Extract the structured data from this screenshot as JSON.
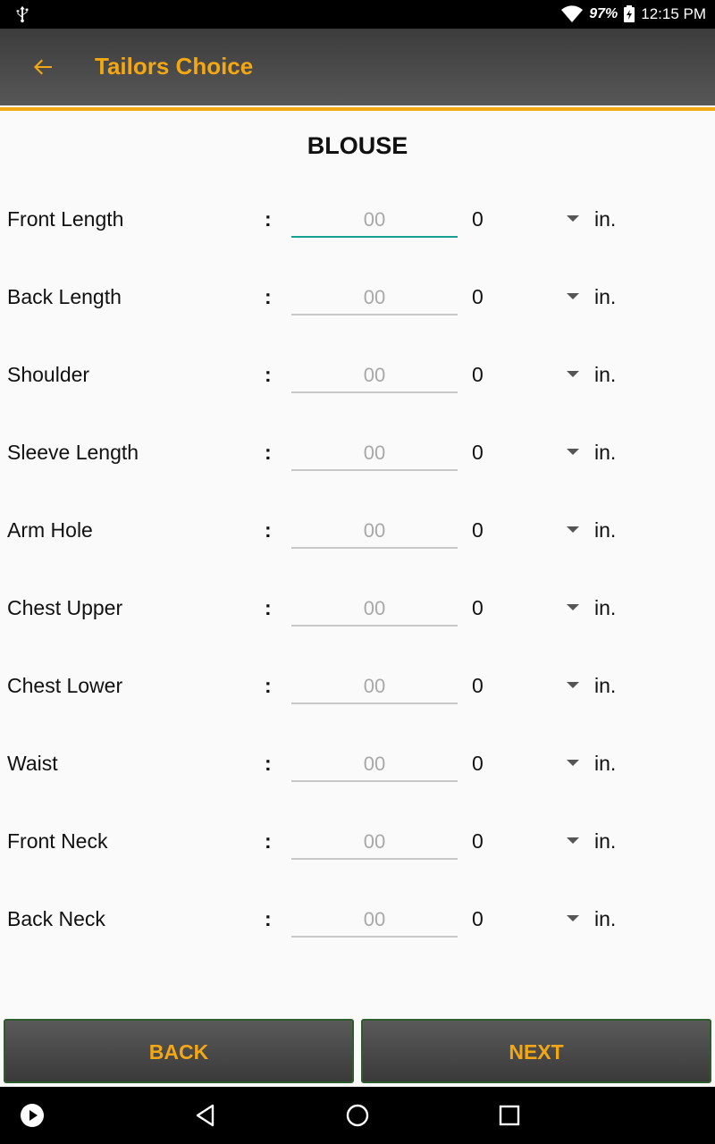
{
  "status_bar": {
    "battery_percent": "97%",
    "time": "12:15 PM",
    "icons": [
      "usb-icon",
      "wifi-icon",
      "battery-charging-icon"
    ]
  },
  "app_bar": {
    "title": "Tailors Choice",
    "back_icon": "arrow-left-icon",
    "title_color": "#f3a712",
    "accent_color": "#f3a712"
  },
  "page": {
    "heading": "BLOUSE"
  },
  "measurements": [
    {
      "label": "Front Length",
      "colon": ":",
      "placeholder": "00",
      "value": "",
      "fraction": "0",
      "unit": "in."
    },
    {
      "label": "Back Length",
      "colon": ":",
      "placeholder": "00",
      "value": "",
      "fraction": "0",
      "unit": "in."
    },
    {
      "label": "Shoulder",
      "colon": ":",
      "placeholder": "00",
      "value": "",
      "fraction": "0",
      "unit": "in."
    },
    {
      "label": "Sleeve Length",
      "colon": ":",
      "placeholder": "00",
      "value": "",
      "fraction": "0",
      "unit": "in."
    },
    {
      "label": "Arm Hole",
      "colon": ":",
      "placeholder": "00",
      "value": "",
      "fraction": "0",
      "unit": "in."
    },
    {
      "label": "Chest Upper",
      "colon": ":",
      "placeholder": "00",
      "value": "",
      "fraction": "0",
      "unit": "in."
    },
    {
      "label": "Chest Lower",
      "colon": ":",
      "placeholder": "00",
      "value": "",
      "fraction": "0",
      "unit": "in."
    },
    {
      "label": "Waist",
      "colon": ":",
      "placeholder": "00",
      "value": "",
      "fraction": "0",
      "unit": "in."
    },
    {
      "label": "Front Neck",
      "colon": ":",
      "placeholder": "00",
      "value": "",
      "fraction": "0",
      "unit": "in."
    },
    {
      "label": "Back Neck",
      "colon": ":",
      "placeholder": "00",
      "value": "",
      "fraction": "0",
      "unit": "in."
    }
  ],
  "buttons": {
    "back_label": "BACK",
    "next_label": "NEXT"
  },
  "nav_bar": {
    "icons": [
      "play-icon",
      "nav-back-icon",
      "home-icon",
      "recents-icon"
    ]
  }
}
